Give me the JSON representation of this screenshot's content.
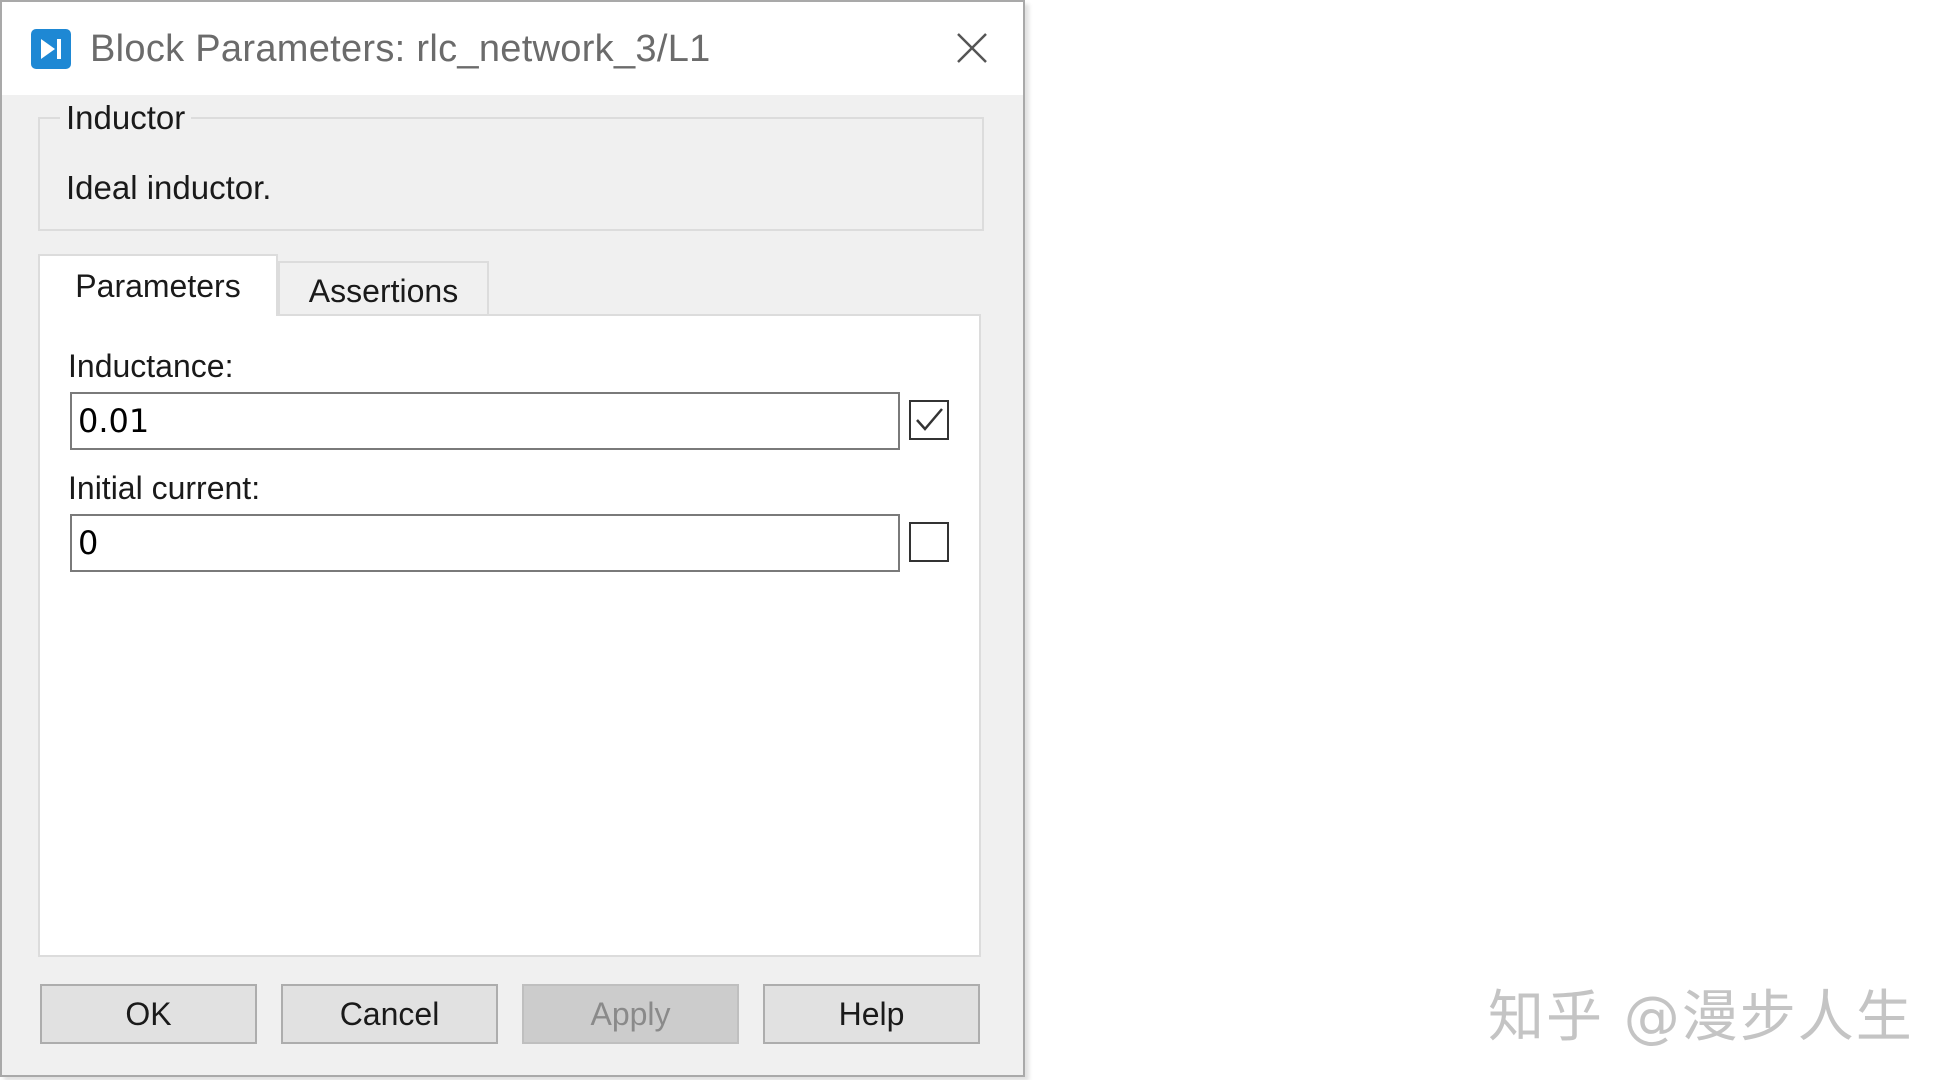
{
  "window": {
    "title": "Block Parameters: rlc_network_3/L1",
    "accent_color": "#1e88d4"
  },
  "description_group": {
    "legend": "Inductor",
    "text": "Ideal inductor."
  },
  "tabs": [
    {
      "label": "Parameters",
      "active": true
    },
    {
      "label": "Assertions",
      "active": false
    }
  ],
  "parameters": [
    {
      "label": "Inductance:",
      "value": "0.01",
      "checked": true
    },
    {
      "label": "Initial current:",
      "value": "0",
      "checked": false
    }
  ],
  "buttons": {
    "ok": "OK",
    "cancel": "Cancel",
    "apply": "Apply",
    "help": "Help"
  },
  "watermark": "知乎 @漫步人生"
}
